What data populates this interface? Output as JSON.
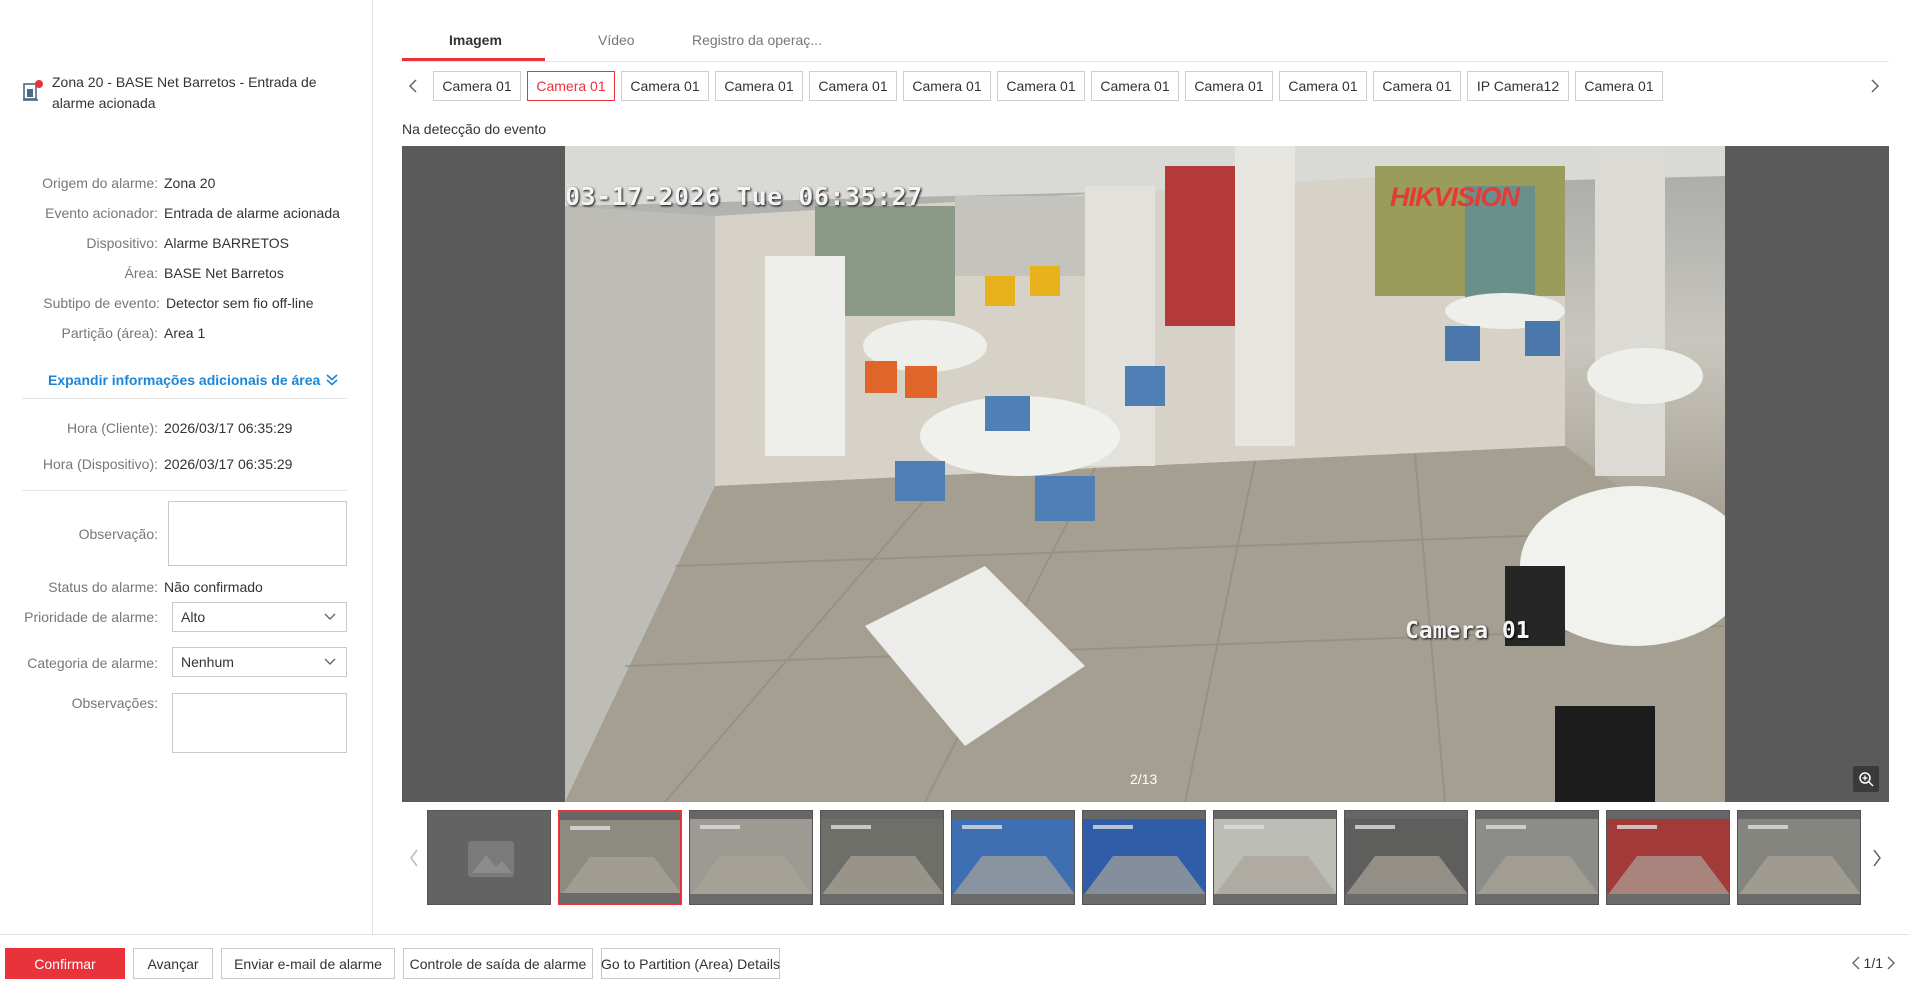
{
  "alarm": {
    "title": "Zona 20 - BASE Net Barretos - Entrada de alarme acionada"
  },
  "details": [
    {
      "label": "Origem do alarme:",
      "value": "Zona 20"
    },
    {
      "label": "Evento acionador:",
      "value": "Entrada de alarme acionada"
    },
    {
      "label": "Dispositivo:",
      "value": "Alarme BARRETOS"
    },
    {
      "label": "Área:",
      "value": "BASE Net Barretos"
    },
    {
      "label": "Subtipo de evento:",
      "value": "Detector sem fio off-line"
    },
    {
      "label": "Partição (área):",
      "value": "Area 1"
    }
  ],
  "expand_label": "Expandir informações adicionais de área",
  "times": [
    {
      "label": "Hora (Cliente):",
      "value": "2026/03/17 06:35:29"
    },
    {
      "label": "Hora (Dispositivo):",
      "value": "2026/03/17 06:35:29"
    }
  ],
  "form": {
    "observacao_label": "Observação:",
    "status_label": "Status do alarme:",
    "status_value": "Não confirmado",
    "priority_label": "Prioridade de alarme:",
    "priority_value": "Alto",
    "category_label": "Categoria de alarme:",
    "category_value": "Nenhum",
    "observacoes_label": "Observações:"
  },
  "tabs": [
    "Imagem",
    "Vídeo",
    "Registro da operaç..."
  ],
  "cameras": [
    "Camera 01",
    "Camera 01",
    "Camera 01",
    "Camera 01",
    "Camera 01",
    "Camera 01",
    "Camera 01",
    "Camera 01",
    "Camera 01",
    "Camera 01",
    "Camera 01",
    "IP Camera12",
    "Camera 01"
  ],
  "selected_camera_index": 1,
  "section_label": "Na detecção do evento",
  "viewer": {
    "osd_time": "03-17-2026 Tue 06:35:27",
    "osd_camera": "Camera 01",
    "brand": "HIKVISION",
    "page_counter": "2/13"
  },
  "thumbnail_count": 11,
  "selected_thumbnail_index": 1,
  "buttons": {
    "confirm": "Confirmar",
    "advance": "Avançar",
    "email": "Enviar e-mail de alarme",
    "output": "Controle de saída de alarme",
    "partition": "Go to Partition (Area) Details"
  },
  "pager": "1/1",
  "colors": {
    "accent": "#e8333a",
    "link": "#1a86d8",
    "viewer_bg": "#5a5a5a"
  }
}
